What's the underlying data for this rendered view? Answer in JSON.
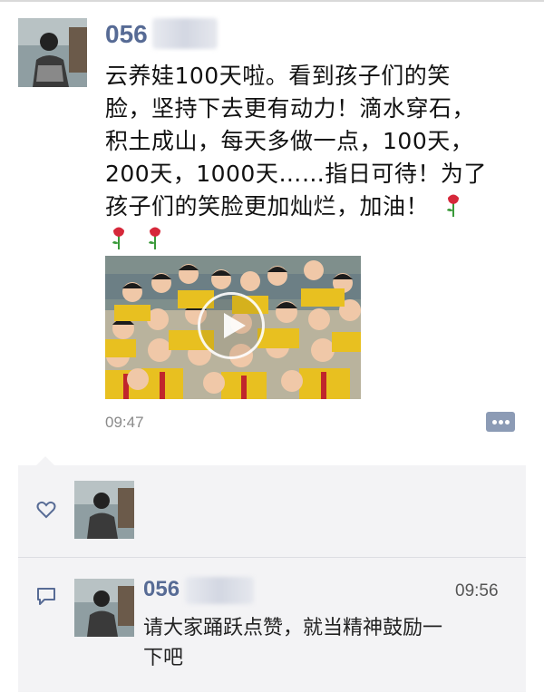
{
  "post": {
    "author_name": "056",
    "text_lines": [
      "云养娃100天啦。看到孩子们的笑",
      "脸，坚持下去更有动力！滴水穿石，",
      "积土成山，每天多做一点，100天，",
      "200天，1000天……指日可待！为了",
      "孩子们的笑脸更加灿烂，加油！",
      ""
    ],
    "time": "09:47"
  },
  "comment": {
    "author_name": "056",
    "time": "09:56",
    "text_lines": [
      "请大家踊跃点赞，就当精神鼓励一",
      "下吧"
    ]
  },
  "icons": {
    "rose": "rose-emoji",
    "play": "play-icon",
    "more": "more-options-icon",
    "like": "heart-icon",
    "comment": "comment-icon"
  },
  "colors": {
    "name": "#576b95",
    "more_button": "#8c9bb5",
    "comment_bg": "#f3f3f5"
  }
}
